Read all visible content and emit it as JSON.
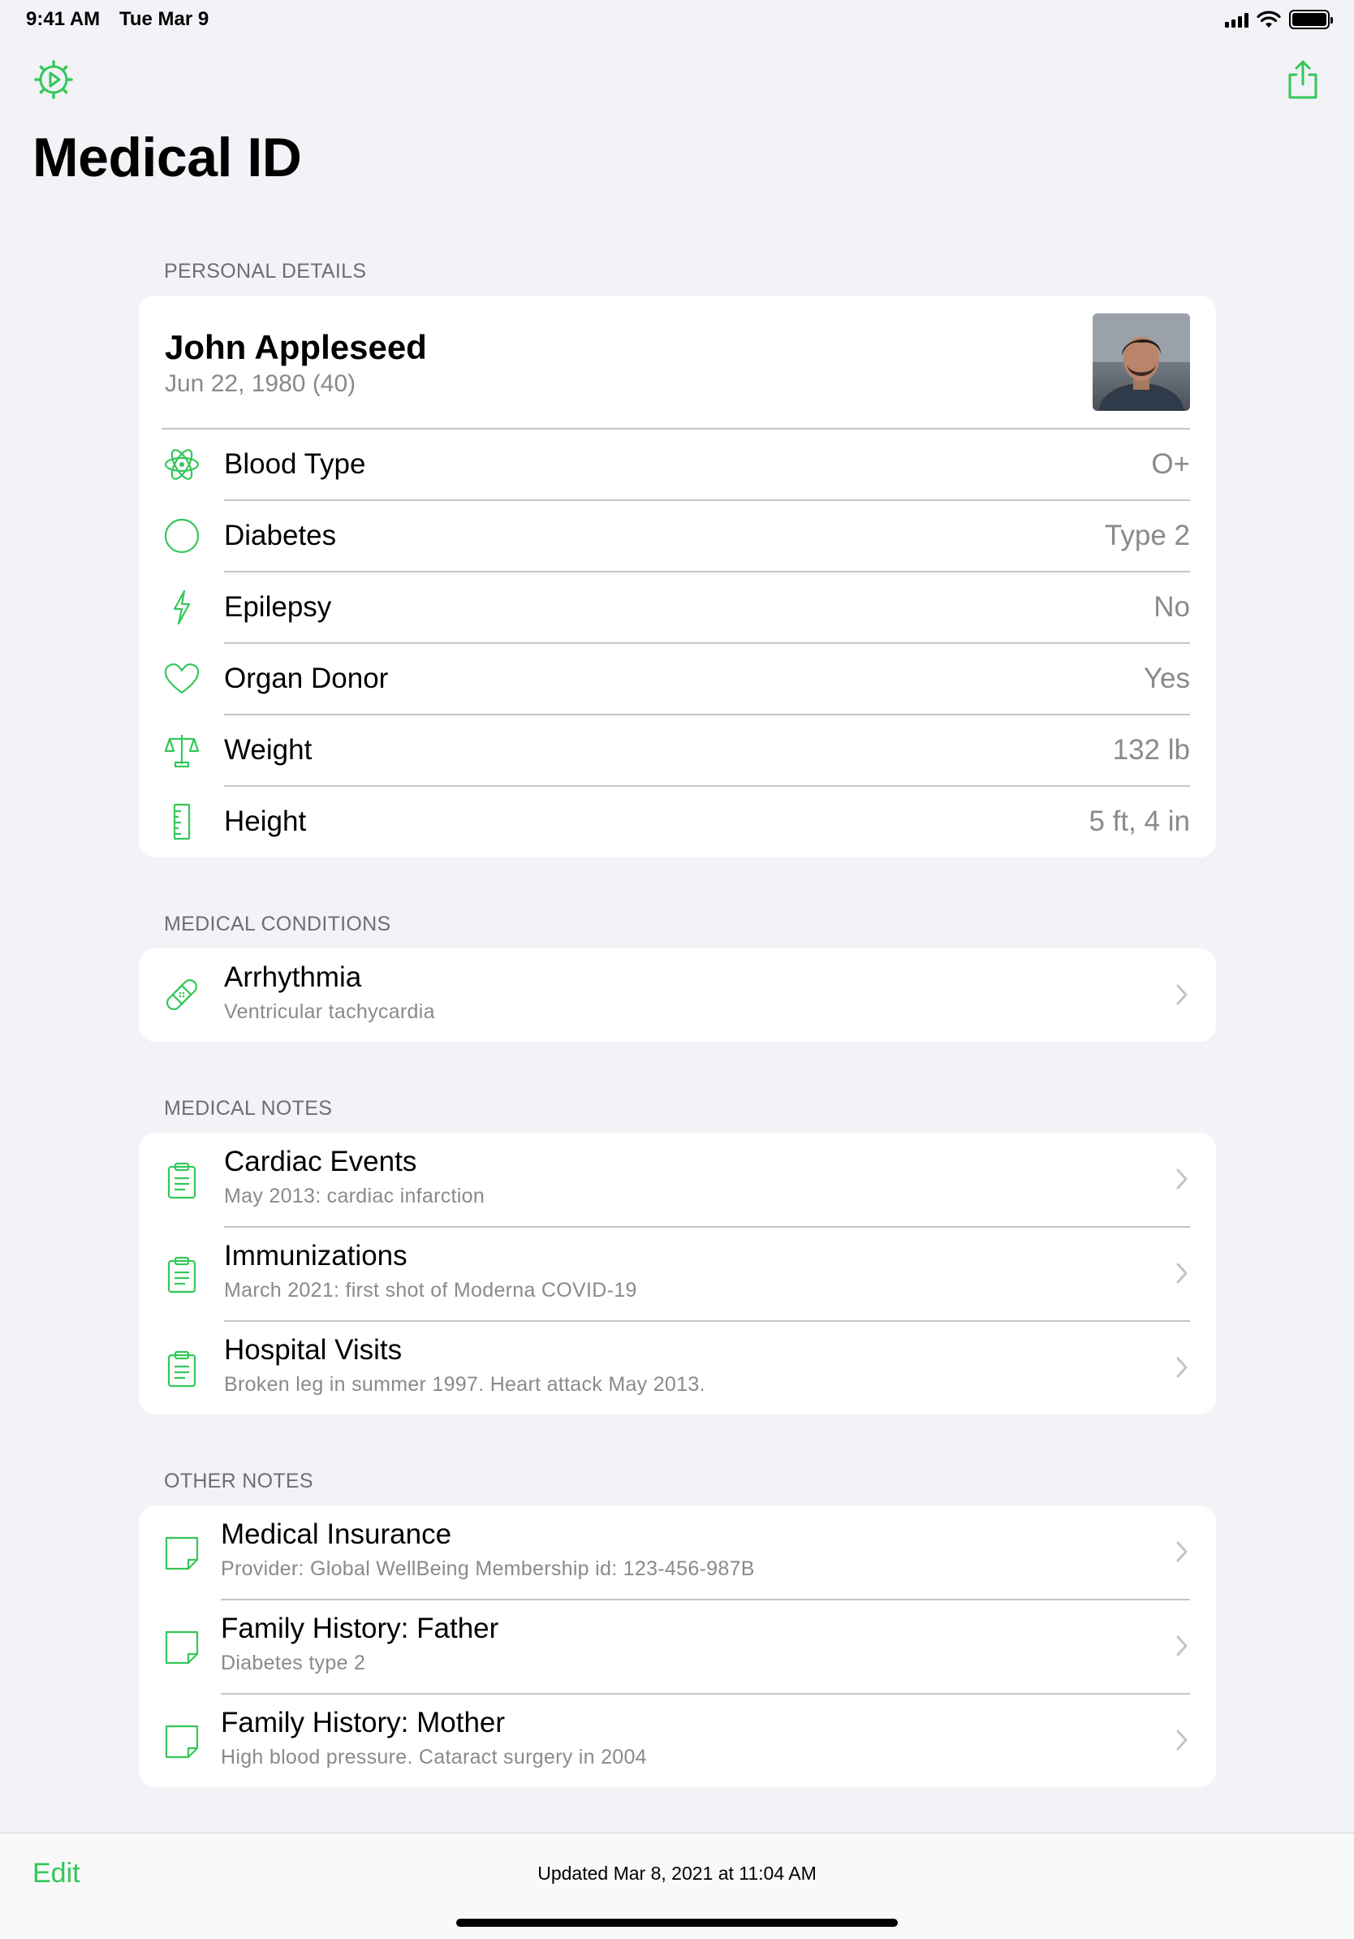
{
  "status": {
    "time": "9:41 AM",
    "date": "Tue Mar 9"
  },
  "header": {
    "title": "Medical ID",
    "left_icon": "emergency-sos-icon",
    "right_icon": "share-icon"
  },
  "personal": {
    "section_title": "PERSONAL DETAILS",
    "name": "John Appleseed",
    "dob": "Jun 22, 1980 (40)",
    "rows": [
      {
        "icon": "atom-icon",
        "label": "Blood Type",
        "value": "O+"
      },
      {
        "icon": "circle-icon",
        "label": "Diabetes",
        "value": "Type 2"
      },
      {
        "icon": "lightning-icon",
        "label": "Epilepsy",
        "value": "No"
      },
      {
        "icon": "heart-icon",
        "label": "Organ Donor",
        "value": "Yes"
      },
      {
        "icon": "scale-icon",
        "label": "Weight",
        "value": "132 lb"
      },
      {
        "icon": "ruler-icon",
        "label": "Height",
        "value": "5 ft, 4 in"
      }
    ]
  },
  "conditions": {
    "section_title": "MEDICAL CONDITIONS",
    "items": [
      {
        "icon": "bandage-icon",
        "title": "Arrhythmia",
        "subtitle": "Ventricular tachycardia"
      }
    ]
  },
  "notes": {
    "section_title": "MEDICAL NOTES",
    "items": [
      {
        "icon": "clipboard-icon",
        "title": "Cardiac Events",
        "subtitle": "May 2013: cardiac infarction"
      },
      {
        "icon": "clipboard-icon",
        "title": "Immunizations",
        "subtitle": "March 2021: first shot of Moderna COVID-19"
      },
      {
        "icon": "clipboard-icon",
        "title": "Hospital Visits",
        "subtitle": "Broken leg in summer 1997. Heart attack May 2013."
      }
    ]
  },
  "other": {
    "section_title": "OTHER NOTES",
    "items": [
      {
        "icon": "note-icon",
        "title": "Medical Insurance",
        "subtitle": "Provider: Global WellBeing Membership id: 123-456-987B"
      },
      {
        "icon": "note-icon",
        "title": "Family History: Father",
        "subtitle": "Diabetes type 2"
      },
      {
        "icon": "note-icon",
        "title": "Family History: Mother",
        "subtitle": "High blood pressure. Cataract surgery in 2004"
      }
    ]
  },
  "footer": {
    "edit_label": "Edit",
    "updated": "Updated Mar 8, 2021 at 11:04 AM"
  },
  "colors": {
    "accent": "#34c759",
    "background": "#f2f2f7",
    "secondary_text": "#8a8a8e"
  }
}
